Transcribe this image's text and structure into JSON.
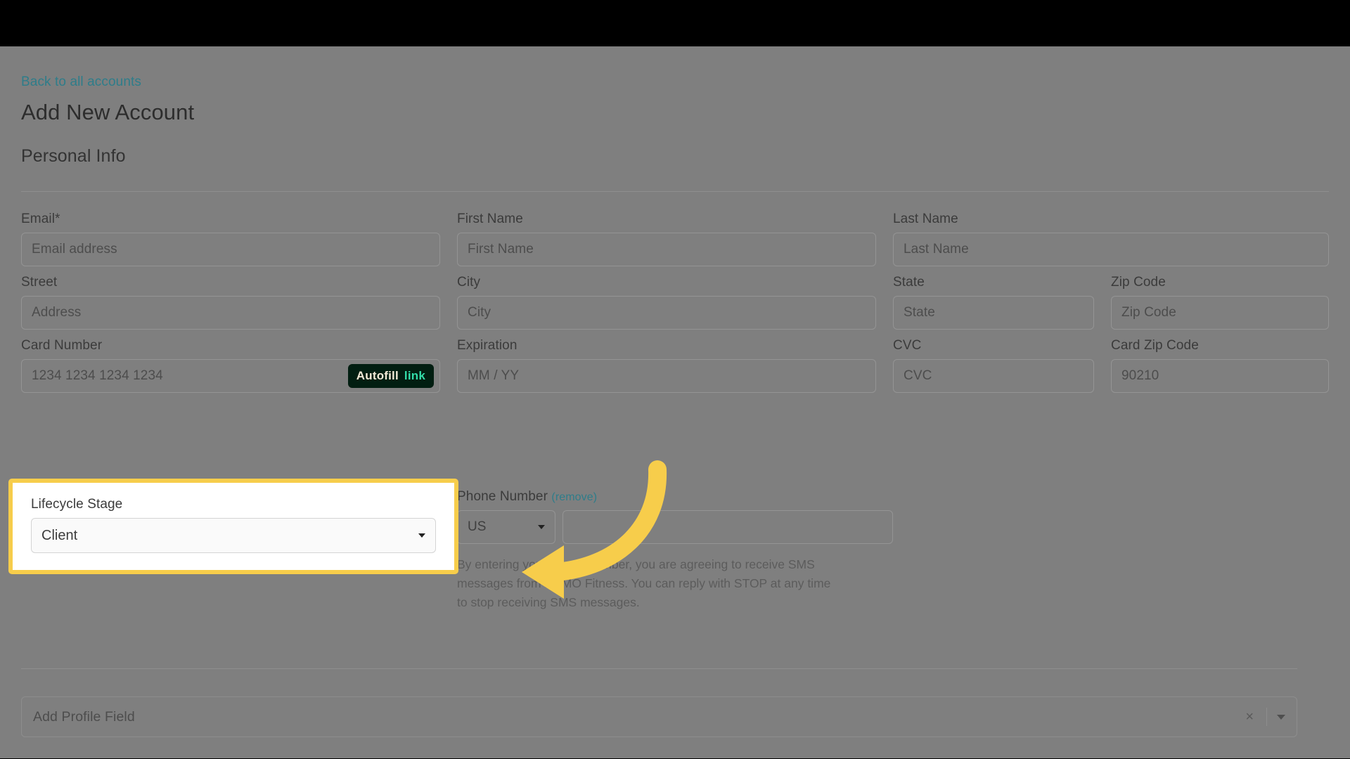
{
  "header": {
    "back_link": "Back to all accounts",
    "title": "Add New Account",
    "section_title": "Personal Info"
  },
  "form": {
    "rows": [
      {
        "fields": [
          {
            "label": "Email*",
            "placeholder": "Email address",
            "value": ""
          },
          {
            "label": "First Name",
            "placeholder": "First Name",
            "value": ""
          },
          {
            "label": "Last Name",
            "placeholder": "Last Name",
            "value": ""
          }
        ]
      },
      {
        "fields": [
          {
            "label": "Street",
            "placeholder": "Address",
            "value": ""
          },
          {
            "label": "City",
            "placeholder": "City",
            "value": ""
          },
          {
            "label": "State",
            "placeholder": "State",
            "value": ""
          },
          {
            "label": "Zip Code",
            "placeholder": "Zip Code",
            "value": ""
          }
        ]
      },
      {
        "fields": [
          {
            "label": "Card Number",
            "placeholder": "1234 1234 1234 1234",
            "value": ""
          },
          {
            "label": "Expiration",
            "placeholder": "MM / YY",
            "value": ""
          },
          {
            "label": "CVC",
            "placeholder": "CVC",
            "value": ""
          },
          {
            "label": "Card Zip Code",
            "placeholder": "90210",
            "value": ""
          }
        ]
      }
    ],
    "autofill_badge": {
      "text": "Autofill",
      "link": "link"
    },
    "lifecycle": {
      "label": "Lifecycle Stage",
      "value": "Client"
    },
    "phone": {
      "label": "Phone Number",
      "remove_label": "(remove)",
      "country": "US",
      "number_placeholder": "",
      "sms_note": "By entering your phone number, you are agreeing to receive SMS messages from DEMO Fitness. You can reply with STOP at any time to stop receiving SMS messages."
    },
    "add_profile_field": {
      "placeholder": "Add Profile Field",
      "clear_icon": "×"
    }
  },
  "colors": {
    "highlight": "#f7cd4b",
    "link": "#2e7d8a",
    "badge_bg": "#011e11",
    "badge_link": "#33ddaa",
    "scrim": "#7f7f7f"
  }
}
